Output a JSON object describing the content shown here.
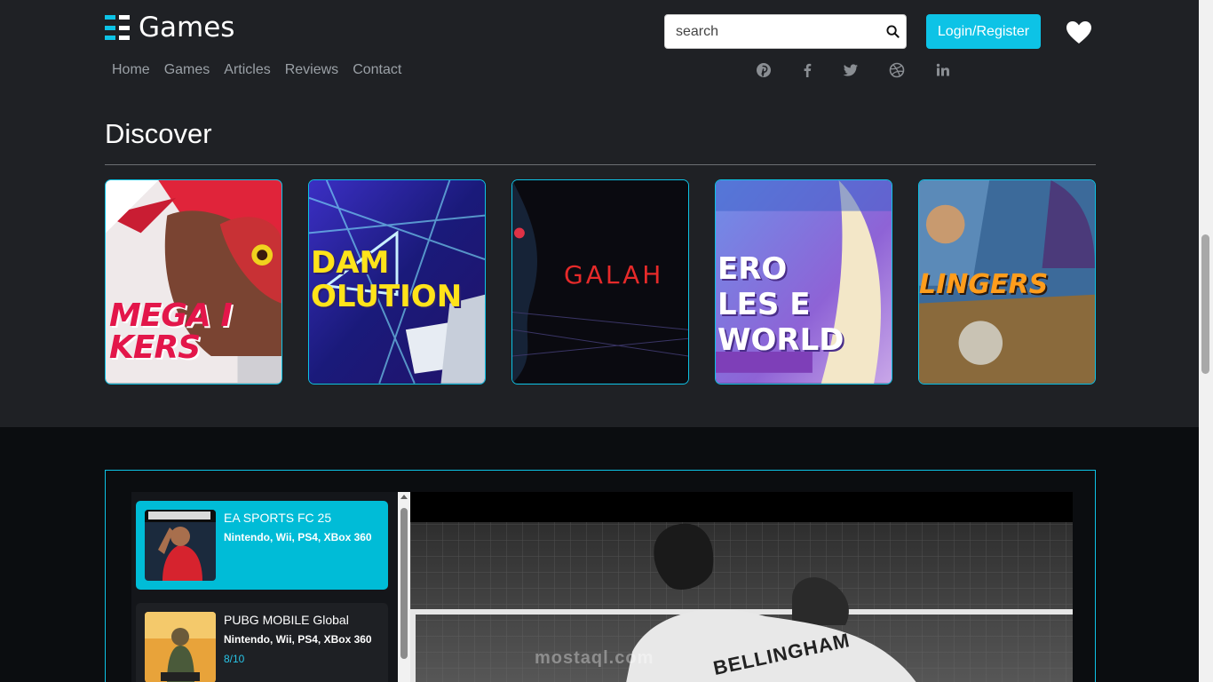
{
  "header": {
    "logo_mark": "ƎE",
    "logo_text": "Games",
    "search_placeholder": "search",
    "login_label": "Login/Register"
  },
  "nav": [
    "Home",
    "Games",
    "Articles",
    "Reviews",
    "Contact"
  ],
  "social_icons": [
    "pinterest-icon",
    "facebook-icon",
    "twitter-icon",
    "dribbble-icon",
    "linkedin-icon"
  ],
  "discover": {
    "title": "Discover",
    "cards": [
      {
        "caption": "MEGA IKERS"
      },
      {
        "caption": "DAM OLUTION"
      },
      {
        "caption": "GALAH"
      },
      {
        "caption": "ERO LES E WORLD"
      },
      {
        "caption": "LINGERS"
      }
    ]
  },
  "games": [
    {
      "name": "EA SPORTS FC 25",
      "platforms": "Nintendo, Wii, PS4, XBox 360",
      "rating": ""
    },
    {
      "name": "PUBG MOBILE Global",
      "platforms": "Nintendo, Wii, PS4, XBox 360",
      "rating": "8/10"
    }
  ],
  "video": {
    "jersey_text": "BELLINGHAM",
    "watermark": "mostaql.com"
  },
  "colors": {
    "accent": "#0dc3e6",
    "header_bg": "#1f2125",
    "body_bg": "#0b0d10"
  }
}
